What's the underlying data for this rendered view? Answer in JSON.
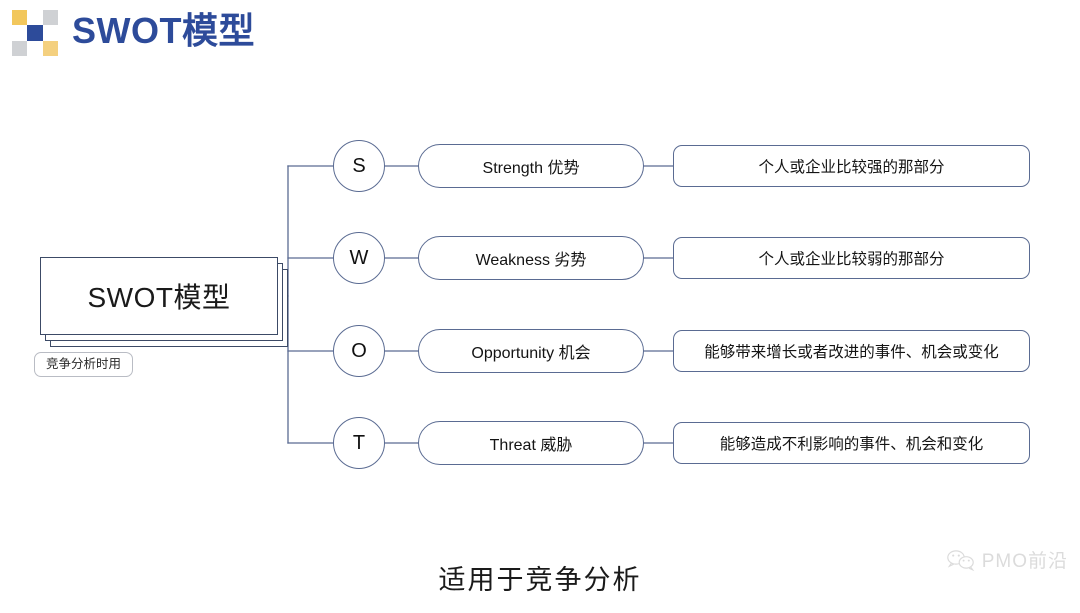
{
  "header": {
    "title": "SWOT模型",
    "logo": {
      "name": "swot-logo-grid",
      "tiles": [
        {
          "color": "#f2c75c"
        },
        {
          "color": "#ffffff"
        },
        {
          "color": "#cfd1d4"
        },
        {
          "color": "#ffffff"
        },
        {
          "color": "#2d4b9a"
        },
        {
          "color": "#ffffff"
        },
        {
          "color": "#cfd1d4"
        },
        {
          "color": "#ffffff"
        },
        {
          "color": "#f4d07f"
        }
      ],
      "accent_blue": "#2d4b9a",
      "accent_yellow": "#f2c75c",
      "accent_gray": "#cfd1d4"
    }
  },
  "diagram": {
    "root": {
      "label": "SWOT模型",
      "tag": "竞争分析时用"
    },
    "branches": [
      {
        "letter": "S",
        "term": "Strength 优势",
        "description": "个人或企业比较强的那部分"
      },
      {
        "letter": "W",
        "term": "Weakness 劣势",
        "description": "个人或企业比较弱的那部分"
      },
      {
        "letter": "O",
        "term": "Opportunity 机会",
        "description": "能够带来增长或者改进的事件、机会或变化"
      },
      {
        "letter": "T",
        "term": "Threat 威胁",
        "description": "能够造成不利影响的事件、机会和变化"
      }
    ],
    "line_color": "#5a6b92",
    "node_border_color": "#5a6b92"
  },
  "footer": {
    "caption": "适用于竞争分析"
  },
  "watermark": {
    "text": "PMO前沿",
    "icon": "wechat-icon"
  }
}
